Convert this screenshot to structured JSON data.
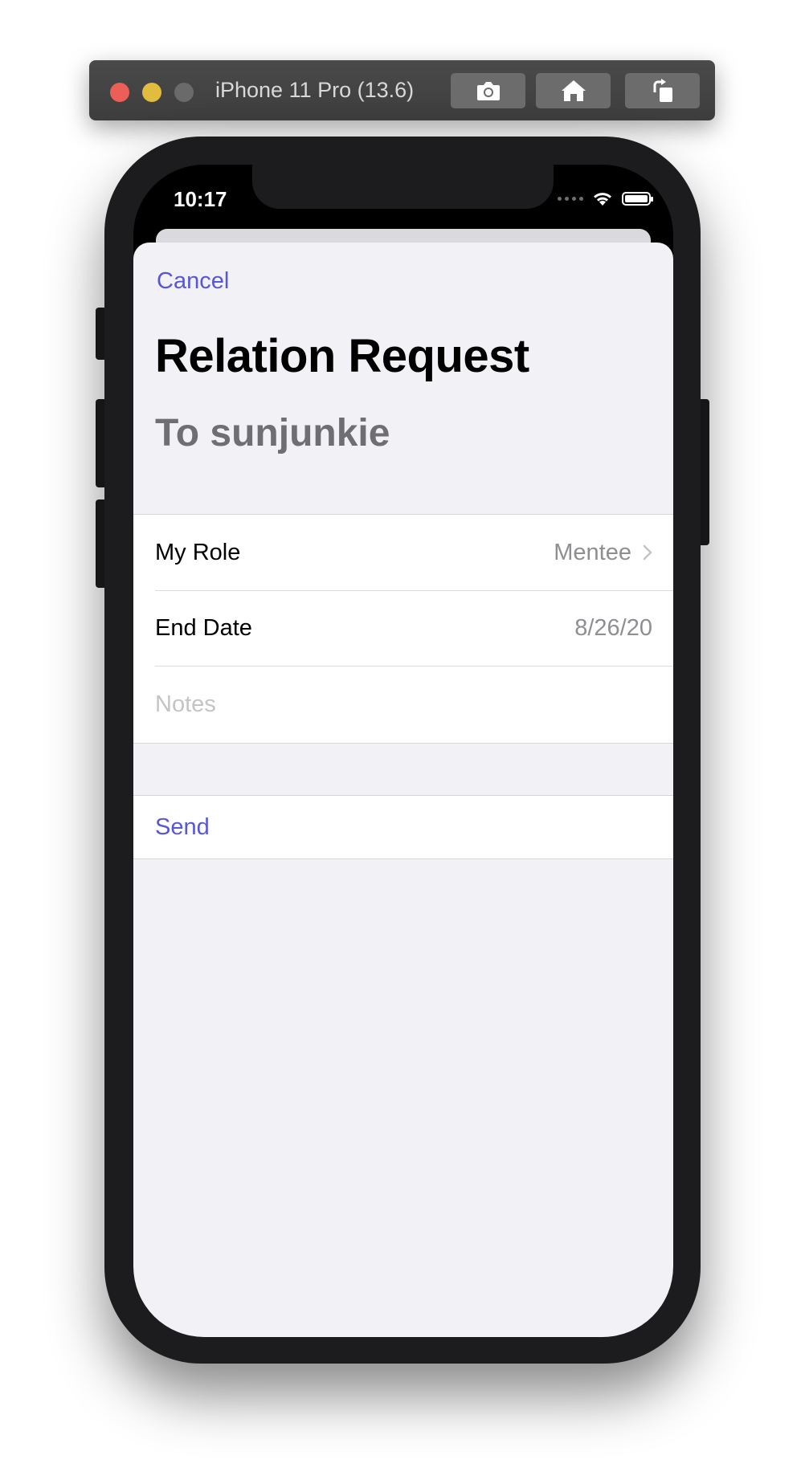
{
  "simulator": {
    "title": "iPhone 11 Pro (13.6)",
    "buttons": [
      "screenshot-icon",
      "home-icon",
      "rotate-icon"
    ]
  },
  "status_bar": {
    "time": "10:17"
  },
  "nav": {
    "cancel_label": "Cancel"
  },
  "header": {
    "title": "Relation Request",
    "subtitle": "To sunjunkie"
  },
  "form": {
    "role": {
      "label": "My Role",
      "value": "Mentee"
    },
    "end_date": {
      "label": "End Date",
      "value": "8/26/20"
    },
    "notes": {
      "placeholder": "Notes"
    }
  },
  "actions": {
    "send_label": "Send"
  },
  "colors": {
    "accent": "#5856d6",
    "background": "#f1f1f6",
    "secondary_text": "#8e8e93"
  }
}
